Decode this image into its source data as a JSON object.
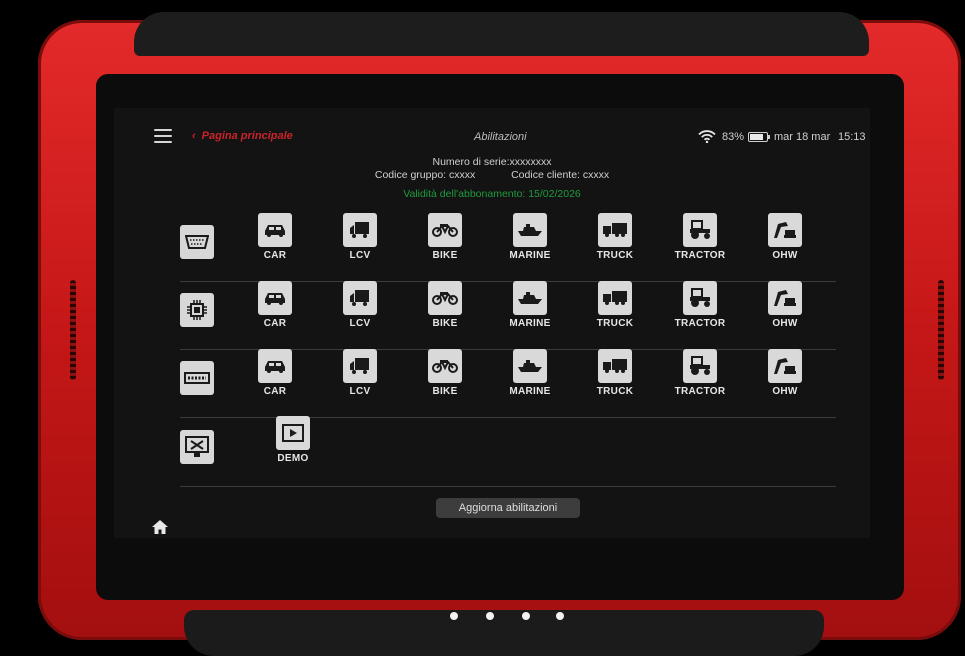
{
  "header": {
    "back_label": "Pagina principale",
    "title": "Abilitazioni",
    "battery_percent": "83%",
    "battery_level": 0.83,
    "date": "mar 18 mar",
    "time": "15:13"
  },
  "info": {
    "serial": "Numero di serie:xxxxxxxx",
    "group_code": "Codice gruppo: cxxxx",
    "client_code": "Codice cliente: cxxxx",
    "validity": "Validità dell'abbonamento: 15/02/2026"
  },
  "vehicle_labels": [
    "CAR",
    "LCV",
    "BIKE",
    "MARINE",
    "TRUCK",
    "TRACTOR",
    "OHW"
  ],
  "rows": [
    {
      "row_icon": "obd-connector-icon"
    },
    {
      "row_icon": "ecu-chip-icon"
    },
    {
      "row_icon": "bench-connector-icon"
    }
  ],
  "demo": {
    "row_icon": "monitor-tools-icon",
    "label": "DEMO"
  },
  "update_button": "Aggiorna abilitazioni",
  "colors": {
    "frame_red": "#d11f1f",
    "accent_red": "#c8242a",
    "validity_green": "#1f9a3e",
    "icon_tile": "#d9d9d9"
  }
}
